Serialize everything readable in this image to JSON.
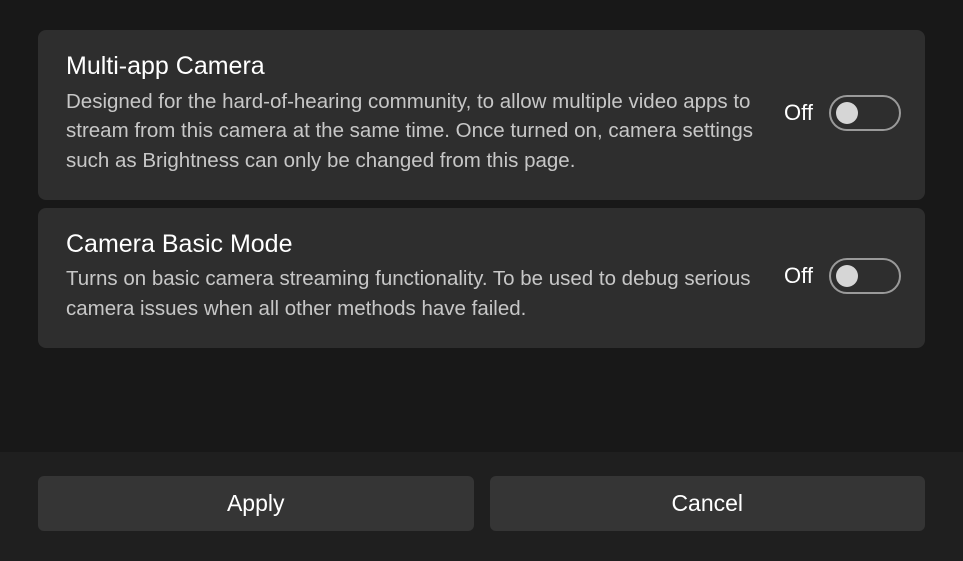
{
  "settings": [
    {
      "title": "Multi-app Camera",
      "description": "Designed for the hard-of-hearing community, to allow multiple video apps to stream from this camera at the same time. Once turned on, camera settings such as Brightness can only be changed from this page.",
      "state": "Off"
    },
    {
      "title": "Camera Basic Mode",
      "description": "Turns on basic camera streaming functionality. To be used to debug serious camera issues when all other methods have failed.",
      "state": "Off"
    }
  ],
  "footer": {
    "apply_label": "Apply",
    "cancel_label": "Cancel"
  }
}
